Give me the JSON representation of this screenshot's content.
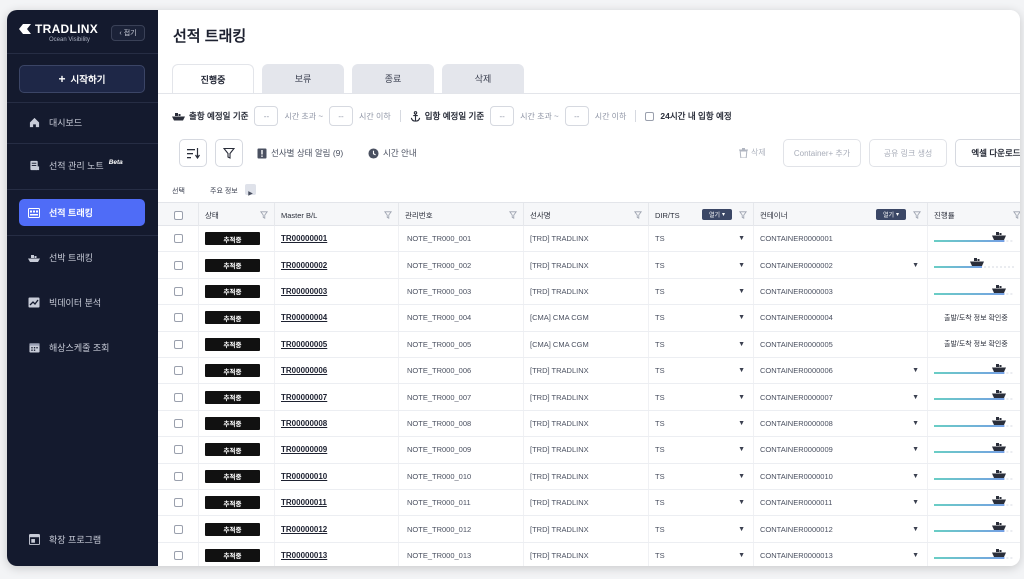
{
  "sidebar": {
    "logo_title": "TRADLINX",
    "logo_subtitle": "Ocean Visibility",
    "collapse_label": "접기",
    "start_label": "시작하기",
    "items": [
      {
        "label": "대시보드",
        "icon": "home-icon"
      },
      {
        "label": "선적 관리 노트",
        "badge": "Beta",
        "icon": "note-icon"
      },
      {
        "label": "선적 트래킹",
        "icon": "tracking-icon",
        "active": true
      },
      {
        "label": "선박 트래킹",
        "icon": "ship-icon"
      },
      {
        "label": "빅데이터 분석",
        "icon": "chart-icon"
      },
      {
        "label": "해상스케줄 조회",
        "icon": "calendar-icon"
      }
    ],
    "footer_label": "확장 프로그램"
  },
  "page": {
    "title": "선적 트래킹",
    "tabs": [
      "진행중",
      "보류",
      "종료",
      "삭제"
    ],
    "active_tab": "진행중"
  },
  "filters": {
    "departure_label": "출항 예정일 기준",
    "arrival_label": "입항 예정일 기준",
    "dash": "--",
    "hours_over": "시간 초과 ~",
    "hours_under": "시간 이하",
    "within24_label": "24시간 내 입항 예정"
  },
  "toolbar": {
    "carrier_alert": "선사별 상태 알림 (9)",
    "time_guide": "시간 안내",
    "delete_label": "삭제",
    "add_container": "Container+ 추가",
    "share_link": "공유 링크 생성",
    "excel_download": "엑셀 다운로드"
  },
  "table": {
    "group_select": "선택",
    "group_main": "주요 정보",
    "headers": {
      "status": "상태",
      "mbl": "Master B/L",
      "mgmt": "관리번호",
      "carrier": "선사명",
      "dir": "DIR/TS",
      "container": "컨테이너",
      "progress": "진행률"
    },
    "open_tag": "열기",
    "rows": [
      {
        "status": "추적중",
        "mbl": "TR00000001",
        "note": "NOTE_TR000_001",
        "carrier": "[TRD] TRADLINX",
        "dir": "TS",
        "container": "CONTAINER0000001",
        "progress": 0.88,
        "note_text": ""
      },
      {
        "status": "추적중",
        "mbl": "TR00000002",
        "note": "NOTE_TR000_002",
        "carrier": "[TRD] TRADLINX",
        "dir": "TS",
        "container": "CONTAINER0000002",
        "progress": 0.6,
        "note_text": ""
      },
      {
        "status": "추적중",
        "mbl": "TR00000003",
        "note": "NOTE_TR000_003",
        "carrier": "[TRD] TRADLINX",
        "dir": "TS",
        "container": "CONTAINER0000003",
        "progress": 0.88,
        "note_text": ""
      },
      {
        "status": "추적중",
        "mbl": "TR00000004",
        "note": "NOTE_TR000_004",
        "carrier": "[CMA] CMA CGM",
        "dir": "TS",
        "container": "CONTAINER0000004",
        "progress": null,
        "note_text": "출발/도착 정보 확인중"
      },
      {
        "status": "추적중",
        "mbl": "TR00000005",
        "note": "NOTE_TR000_005",
        "carrier": "[CMA] CMA CGM",
        "dir": "TS",
        "container": "CONTAINER0000005",
        "progress": null,
        "note_text": "출발/도착 정보 확인중"
      },
      {
        "status": "추적중",
        "mbl": "TR00000006",
        "note": "NOTE_TR000_006",
        "carrier": "[TRD] TRADLINX",
        "dir": "TS",
        "container": "CONTAINER0000006",
        "progress": 0.88,
        "note_text": ""
      },
      {
        "status": "추적중",
        "mbl": "TR00000007",
        "note": "NOTE_TR000_007",
        "carrier": "[TRD] TRADLINX",
        "dir": "TS",
        "container": "CONTAINER0000007",
        "progress": 0.88,
        "note_text": ""
      },
      {
        "status": "추적중",
        "mbl": "TR00000008",
        "note": "NOTE_TR000_008",
        "carrier": "[TRD] TRADLINX",
        "dir": "TS",
        "container": "CONTAINER0000008",
        "progress": 0.88,
        "note_text": ""
      },
      {
        "status": "추적중",
        "mbl": "TR00000009",
        "note": "NOTE_TR000_009",
        "carrier": "[TRD] TRADLINX",
        "dir": "TS",
        "container": "CONTAINER0000009",
        "progress": 0.88,
        "note_text": ""
      },
      {
        "status": "추적중",
        "mbl": "TR00000010",
        "note": "NOTE_TR000_010",
        "carrier": "[TRD] TRADLINX",
        "dir": "TS",
        "container": "CONTAINER0000010",
        "progress": 0.88,
        "note_text": ""
      },
      {
        "status": "추적중",
        "mbl": "TR00000011",
        "note": "NOTE_TR000_011",
        "carrier": "[TRD] TRADLINX",
        "dir": "TS",
        "container": "CONTAINER0000011",
        "progress": 0.88,
        "note_text": ""
      },
      {
        "status": "추적중",
        "mbl": "TR00000012",
        "note": "NOTE_TR000_012",
        "carrier": "[TRD] TRADLINX",
        "dir": "TS",
        "container": "CONTAINER0000012",
        "progress": 0.88,
        "note_text": ""
      },
      {
        "status": "추적중",
        "mbl": "TR00000013",
        "note": "NOTE_TR000_013",
        "carrier": "[TRD] TRADLINX",
        "dir": "TS",
        "container": "CONTAINER0000013",
        "progress": 0.88,
        "note_text": ""
      }
    ]
  },
  "colors": {
    "sidebar_bg": "#141a2e",
    "accent": "#4f6cf7",
    "progress_start": "#1fb5a8",
    "progress_end": "#2f6fd6"
  }
}
